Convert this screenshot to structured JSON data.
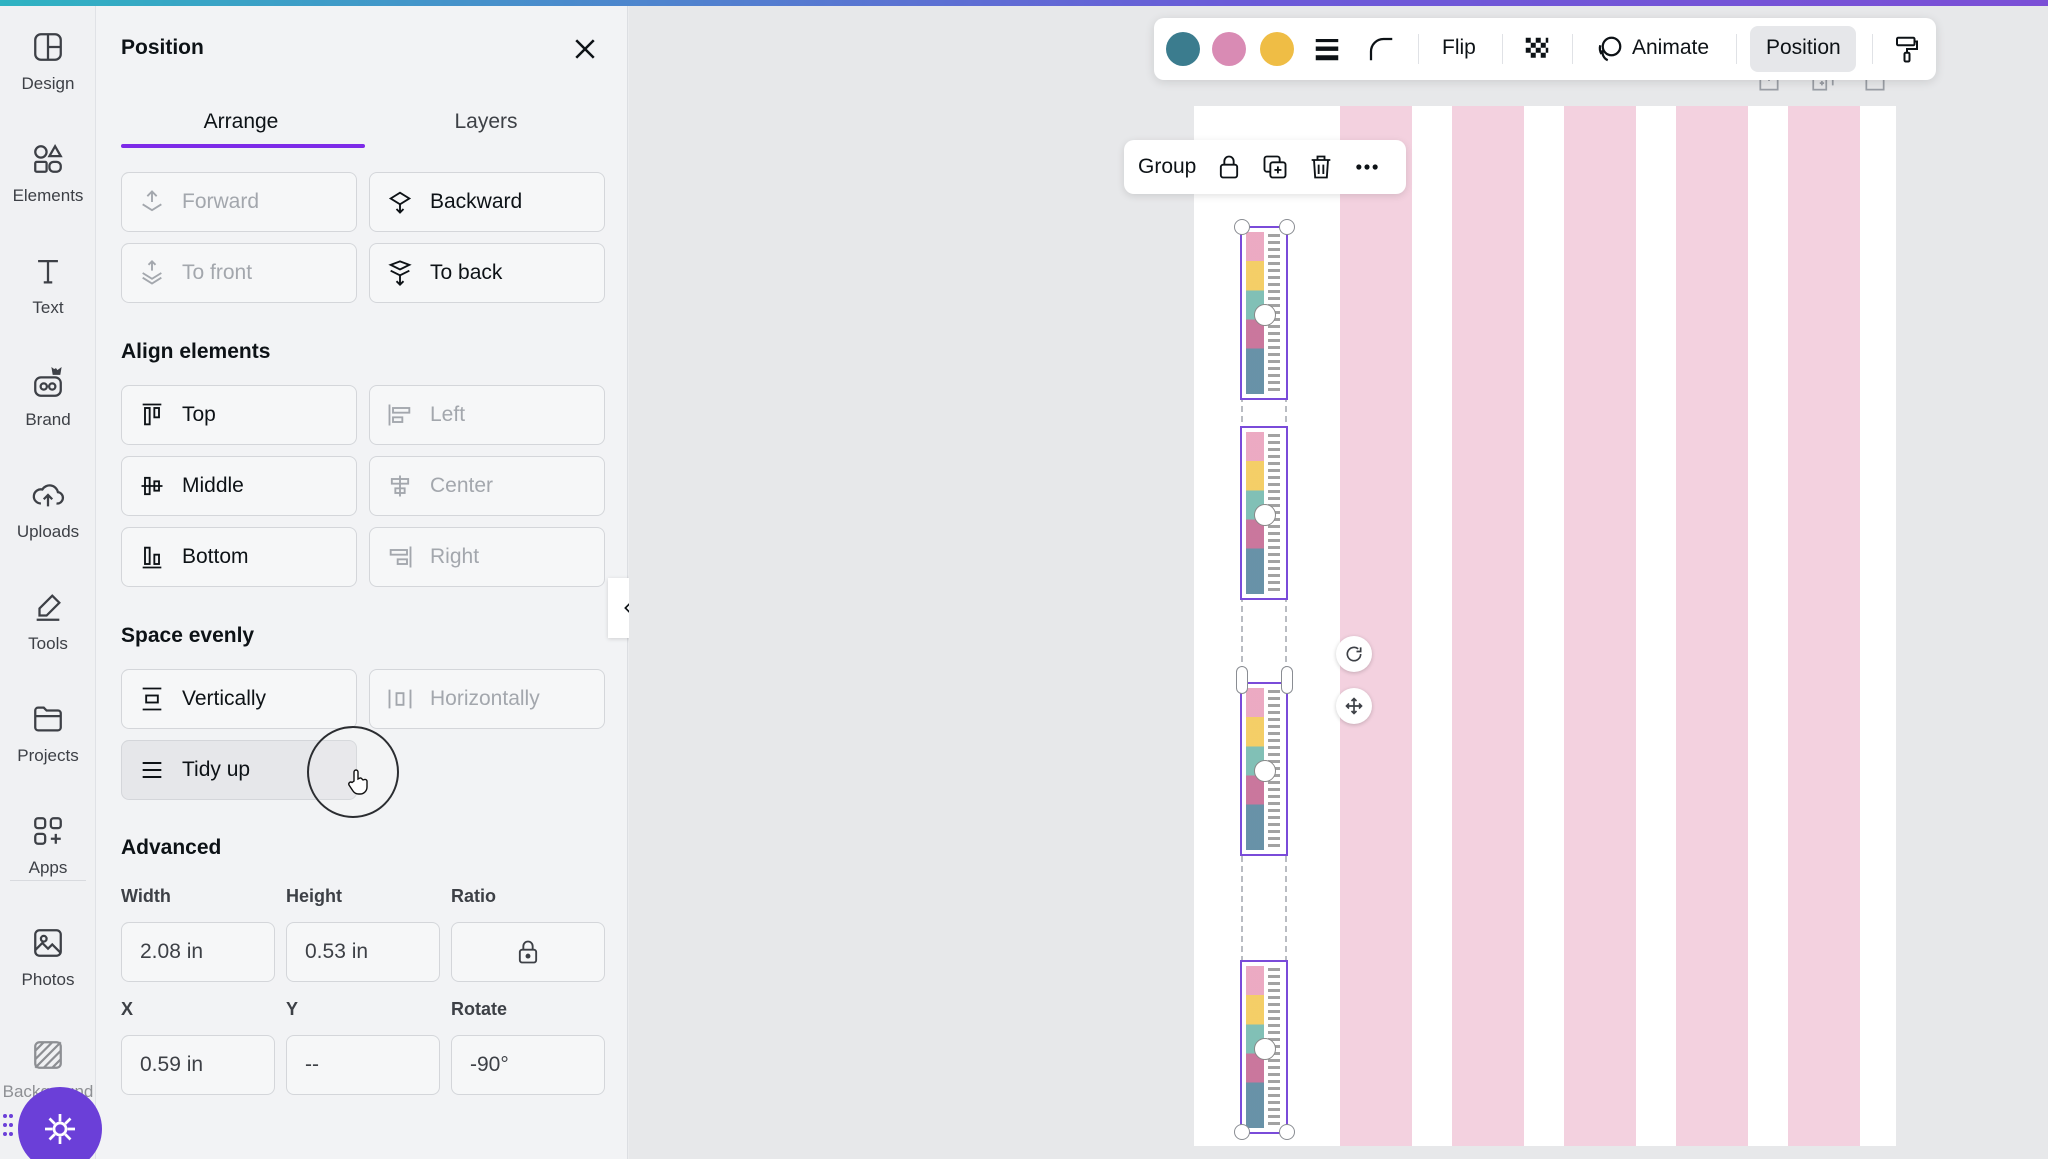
{
  "left_rail": {
    "items": [
      {
        "label": "Design",
        "icon": "design-icon"
      },
      {
        "label": "Elements",
        "icon": "elements-icon"
      },
      {
        "label": "Text",
        "icon": "text-icon"
      },
      {
        "label": "Brand",
        "icon": "brand-icon"
      },
      {
        "label": "Uploads",
        "icon": "uploads-icon"
      },
      {
        "label": "Tools",
        "icon": "tools-icon"
      },
      {
        "label": "Projects",
        "icon": "projects-icon"
      },
      {
        "label": "Apps",
        "icon": "apps-icon"
      },
      {
        "label": "Photos",
        "icon": "photos-icon"
      },
      {
        "label": "Background",
        "icon": "background-icon"
      }
    ]
  },
  "panel": {
    "title": "Position",
    "tabs": [
      {
        "label": "Arrange",
        "active": true
      },
      {
        "label": "Layers",
        "active": false
      }
    ],
    "arrange_buttons": [
      {
        "label": "Forward",
        "enabled": false
      },
      {
        "label": "Backward",
        "enabled": true
      },
      {
        "label": "To front",
        "enabled": false
      },
      {
        "label": "To back",
        "enabled": true
      }
    ],
    "align_heading": "Align elements",
    "align_buttons": [
      {
        "label": "Top",
        "enabled": true
      },
      {
        "label": "Left",
        "enabled": false
      },
      {
        "label": "Middle",
        "enabled": true
      },
      {
        "label": "Center",
        "enabled": false
      },
      {
        "label": "Bottom",
        "enabled": true
      },
      {
        "label": "Right",
        "enabled": false
      }
    ],
    "space_heading": "Space evenly",
    "space_buttons": [
      {
        "label": "Vertically",
        "enabled": true
      },
      {
        "label": "Horizontally",
        "enabled": false
      },
      {
        "label": "Tidy up",
        "enabled": true
      }
    ],
    "advanced_heading": "Advanced",
    "fields": {
      "width": {
        "label": "Width",
        "value": "2.08 in"
      },
      "height": {
        "label": "Height",
        "value": "0.53 in"
      },
      "ratio": {
        "label": "Ratio",
        "icon": "lock-icon"
      },
      "x": {
        "label": "X",
        "value": "0.59 in"
      },
      "y": {
        "label": "Y",
        "value": "--"
      },
      "rotate": {
        "label": "Rotate",
        "value": "-90°"
      }
    }
  },
  "group_bar": {
    "label": "Group",
    "icons": [
      "lock-icon",
      "duplicate-icon",
      "trash-icon",
      "more-icon"
    ]
  },
  "toolbar": {
    "swatches": [
      "#3b7c8e",
      "#d98bb4",
      "#efbd45"
    ],
    "flip_label": "Flip",
    "animate_label": "Animate",
    "position_label": "Position"
  },
  "colors": {
    "accent": "#7d2ae8",
    "stripe": "#f3d1df",
    "magic": "#6b3fd8"
  }
}
